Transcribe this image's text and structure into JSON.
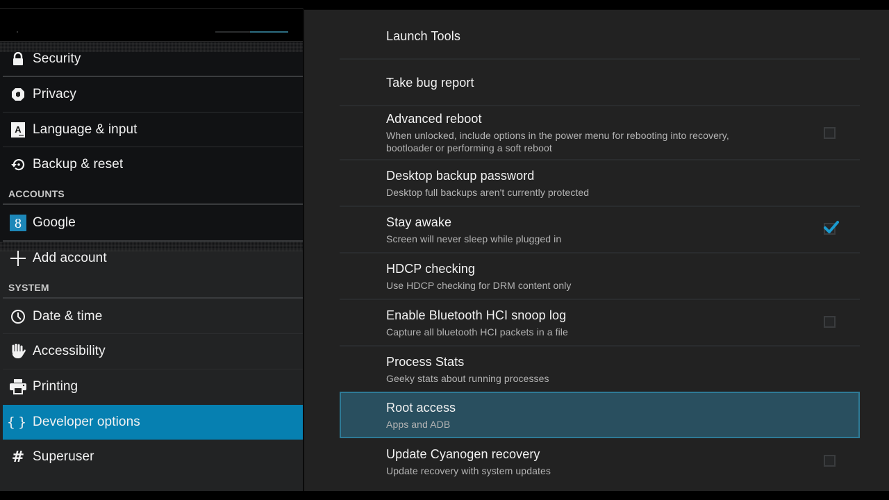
{
  "sidebar": {
    "sections": {
      "accounts": "ACCOUNTS",
      "system": "SYSTEM"
    },
    "items": [
      {
        "id": "security",
        "label": "Security",
        "icon": "lock-icon"
      },
      {
        "id": "privacy",
        "label": "Privacy",
        "icon": "privacy-guard-icon"
      },
      {
        "id": "language",
        "label": "Language & input",
        "icon": "keyboard-language-icon"
      },
      {
        "id": "backup",
        "label": "Backup & reset",
        "icon": "backup-restore-icon"
      },
      {
        "id": "google",
        "label": "Google",
        "icon": "google-account-icon"
      },
      {
        "id": "add-account",
        "label": "Add account",
        "icon": "plus-icon"
      },
      {
        "id": "date-time",
        "label": "Date & time",
        "icon": "clock-icon"
      },
      {
        "id": "accessibility",
        "label": "Accessibility",
        "icon": "hand-icon"
      },
      {
        "id": "printing",
        "label": "Printing",
        "icon": "printer-icon"
      },
      {
        "id": "developer",
        "label": "Developer options",
        "icon": "braces-icon",
        "active": true
      },
      {
        "id": "superuser",
        "label": "Superuser",
        "icon": "hash-icon"
      }
    ],
    "top_indicator_fraction": 0.52
  },
  "main": {
    "preferences": [
      {
        "title": "Launch Tools",
        "summary": ""
      },
      {
        "title": "Take bug report",
        "summary": ""
      },
      {
        "title": "Advanced reboot",
        "summary_line1": "When unlocked, include options in the power menu for rebooting into recovery,",
        "summary_line2": "bootloader or performing a soft reboot",
        "checkbox": true,
        "checked": false
      },
      {
        "title": "Desktop backup password",
        "summary": "Desktop full backups aren't currently protected"
      },
      {
        "title": "Stay awake",
        "summary": "Screen will never sleep while plugged in",
        "checkbox": true,
        "checked": true
      },
      {
        "title": "HDCP checking",
        "summary": "Use HDCP checking for DRM content only"
      },
      {
        "title": "Enable Bluetooth HCI snoop log",
        "summary": "Capture all bluetooth HCI packets in a file",
        "checkbox": true,
        "checked": false
      },
      {
        "title": "Process Stats",
        "summary": "Geeky stats about running processes"
      },
      {
        "title": "Root access",
        "summary": "Apps and ADB",
        "focused": true
      },
      {
        "title": "Update Cyanogen recovery",
        "summary": "Update recovery with system updates",
        "checkbox": true,
        "checked": false
      }
    ]
  },
  "colors": {
    "accent": "#0680b1",
    "focus_bg": "#294f5f",
    "focus_border": "#2e7a96",
    "check": "#1a9bd0"
  }
}
